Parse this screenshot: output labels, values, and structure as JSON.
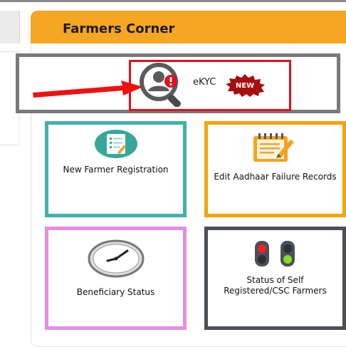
{
  "panel": {
    "title": "Farmers Corner"
  },
  "ekyc": {
    "label": "eKYC",
    "badge": "NEW"
  },
  "cards": {
    "new_farmer_registration": "New Farmer Registration",
    "edit_aadhaar_failure": "Edit Aadhaar Failure Records",
    "beneficiary_status": "Beneficiary Status",
    "status_self_registered_line1": "Status of Self",
    "status_self_registered_line2": "Registered/CSC Farmers"
  },
  "colors": {
    "header": "#f5a623",
    "highlight_gray": "#7a7a7a",
    "highlight_red": "#e0101e",
    "teal": "#41b2a8",
    "orange": "#f5a30c",
    "pink": "#e68de3",
    "dark": "#4a4f58"
  },
  "icons": {
    "ekyc": "user-search-alert-icon",
    "new_farmer": "registration-form-icon",
    "edit_aadhaar": "edit-document-icon",
    "beneficiary": "clock-icon",
    "status": "traffic-signal-icon"
  }
}
